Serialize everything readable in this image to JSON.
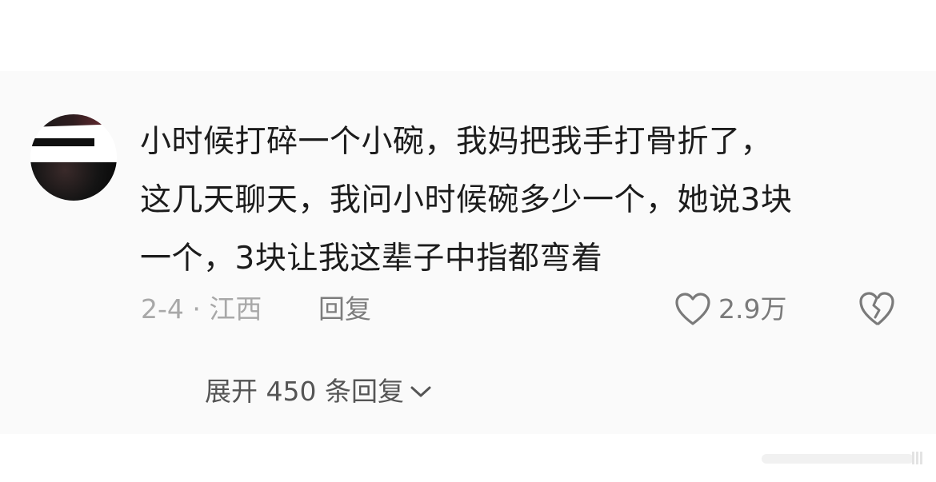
{
  "comment": {
    "lines": [
      "小时候打碎一个小碗，我妈把我手打骨折了，",
      "这几天聊天，我问小时候碗多少一个，她说3块",
      "一个，3块让我这辈子中指都弯着"
    ],
    "date_location": "2-4 · 江西",
    "reply_label": "回复",
    "like_count": "2.9万"
  },
  "replies": {
    "expand_label": "展开 450 条回复"
  },
  "icons": {
    "like": "heart-outline-icon",
    "dislike": "broken-heart-icon",
    "expand": "chevron-down-icon"
  },
  "colors": {
    "text_primary": "#1c1c1c",
    "text_meta": "#a8a8a8",
    "text_action": "#7d7d7d",
    "card_background": "#fafafa"
  }
}
